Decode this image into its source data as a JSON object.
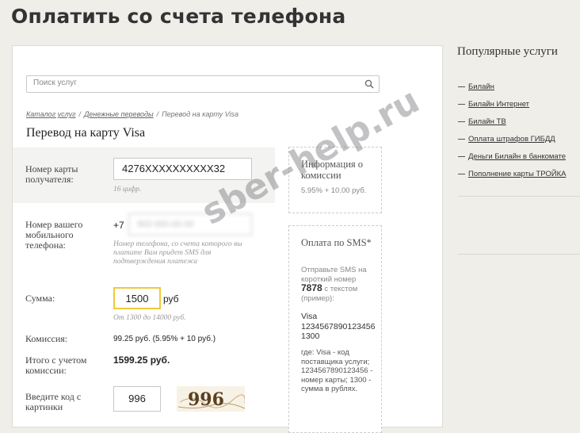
{
  "page": {
    "title": "Оплатить со счета телефона"
  },
  "search": {
    "placeholder": "Поиск услуг"
  },
  "breadcrumb": [
    {
      "label": "Каталог услуг"
    },
    {
      "label": "Денежные переводы"
    },
    {
      "label": "Перевод на карту Visa"
    }
  ],
  "form": {
    "title": "Перевод на карту Visa",
    "card_number": {
      "label": "Номер карты получателя:",
      "value": "4276XXXXXXXXXX32",
      "hint": "16 цифр."
    },
    "phone": {
      "label": "Номер вашего мобильного телефона:",
      "prefix": "+7",
      "value": "903 000-00-00",
      "hint": "Номер телефона, со счета которого вы платите Вам придет SMS для подтверждения платежа"
    },
    "amount": {
      "label": "Сумма:",
      "value": "1500",
      "unit": "руб",
      "hint": "От 1300 до 14000 руб."
    },
    "commission": {
      "label": "Комиссия:",
      "value": "99.25 руб. (5.95% + 10 руб.)"
    },
    "total": {
      "label": "Итого с учетом комиссии:",
      "value": "1599.25 руб."
    },
    "captcha": {
      "label": "Введите код с картинки",
      "value": "996",
      "image_text": "996"
    }
  },
  "info_box": {
    "title": "Информация о комиссии",
    "text": "5.95% + 10.00 руб."
  },
  "sms_box": {
    "title": "Оплата по SMS*",
    "intro_start": "Отправьте SMS на короткий номер",
    "short_number": "7878",
    "intro_end": "с текстом (пример):",
    "example": "Visa 1234567890123456 1300",
    "explanation": "где: Visa - код поставщика услуги; 1234567890123456 - номер карты; 1300 - сумма в рублях."
  },
  "sidebar": {
    "title": "Популярные услуги",
    "links": [
      {
        "label": "Билайн"
      },
      {
        "label": "Билайн Интернет"
      },
      {
        "label": "Билайн ТВ"
      },
      {
        "label": "Оплата штрафов ГИБДД"
      },
      {
        "label": "Деньги Билайн в банкомате"
      },
      {
        "label": "Пополнение карты ТРОЙКА"
      }
    ]
  },
  "watermark": {
    "text": "sber-help.ru"
  },
  "colors": {
    "background": "#efeee9",
    "amount_border": "#f0c83c"
  }
}
